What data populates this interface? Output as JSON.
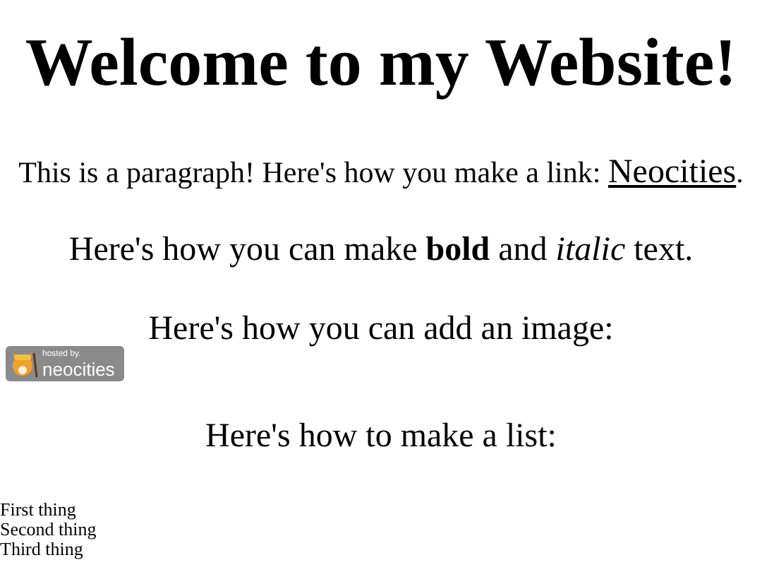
{
  "heading": "Welcome to my Website!",
  "intro": {
    "before": "This is a paragraph! Here's how you make a link: ",
    "link": "Neocities",
    "after": "."
  },
  "formatting": "Here's how you can make **bold** and *italic* text.",
  "image_caption": "Here's how you can add an image:",
  "badge": {
    "line_1": "hosted by.",
    "line_2": "neocities"
  },
  "list_caption": "Here's how to make a list:",
  "list_items": [
    "First thing",
    "Second thing",
    "Third thing"
  ]
}
